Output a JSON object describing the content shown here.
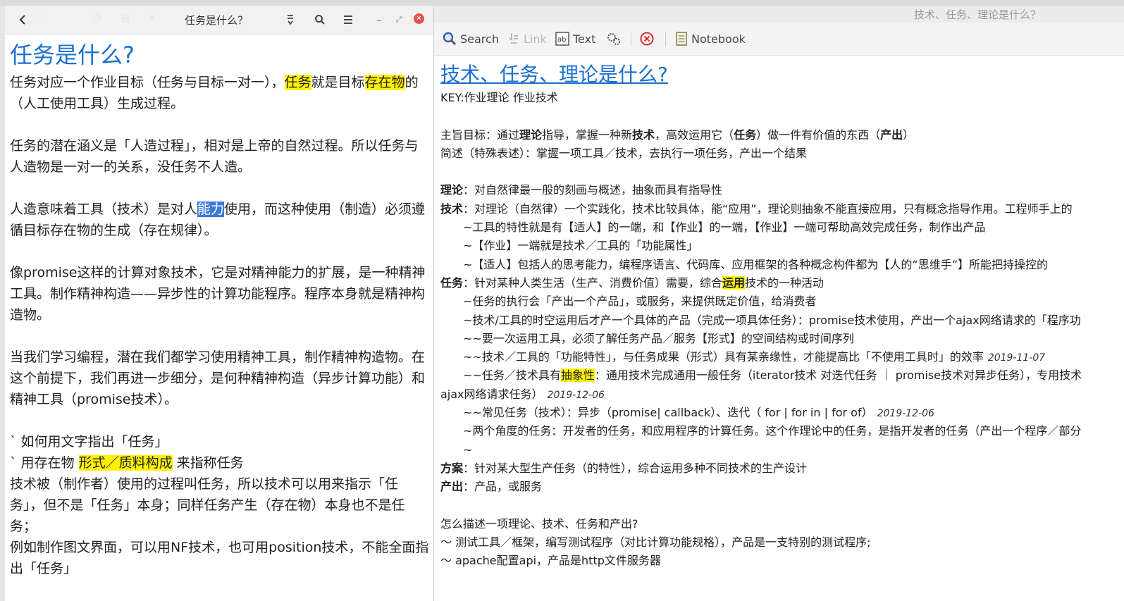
{
  "left_window": {
    "title": "任务是什么？",
    "heading": "任务是什么?",
    "para1_a": "任务对应一个作业目标（任务与目标一对一），",
    "para1_hl1": "任务",
    "para1_b": "就是目标",
    "para1_hl2": "存在物",
    "para1_c": "的（人工使用工具）生成过程。",
    "para2": "任务的潜在涵义是「人造过程」，相对是上帝的自然过程。所以任务与人造物是一对一的关系，没任务不人造。",
    "para3_a": "人造意味着工具（技术）是对人",
    "para3_sel": "能力",
    "para3_b": "使用，而这种使用（制造）必须遵循目标存在物的生成（存在规律）。",
    "para4": "像promise这样的计算对象技术，它是对精神能力的扩展，是一种精神工具。制作精神构造——异步性的计算功能程序。程序本身就是精神构造物。",
    "para5": "当我们学习编程，潜在我们都学习使用精神工具，制作精神构造物。在这个前提下，我们再进一步细分，是何种精神构造（异步计算功能）和精神工具（promise技术）。",
    "bullet1": "` 如何用文字指出「任务」",
    "bullet2_a": "` 用存在物 ",
    "bullet2_hl": "形式／质料构成",
    "bullet2_b": " 来指称任务",
    "para6": "技术被（制作者）使用的过程叫任务，所以技术可以用来指示「任务」，但不是「任务」本身；同样任务产生（存在物）本身也不是任务；",
    "para7": "例如制作图文界面，可以用NF技术，也可用position技术，不能全面指出「任务」"
  },
  "right_window": {
    "title": "技术、任务、理论是什么？",
    "toolbar": {
      "search": "Search",
      "link": "Link",
      "text": "Text",
      "notebook": "Notebook"
    },
    "heading": "技术、任务、理论是什么?",
    "key": "KEY:作业理论 作业技术",
    "l_goal_a": "主旨目标：通过",
    "l_goal_b1": "理论",
    "l_goal_c": "指导，掌握一种新",
    "l_goal_b2": "技术",
    "l_goal_d": "，高效运用它（",
    "l_goal_b3": "任务",
    "l_goal_e": "）做一件有价值的东西（",
    "l_goal_b4": "产出",
    "l_goal_f": "）",
    "l_brief": "简述（特殊表述）：掌握一项工具／技术，去执行一项任务，产出一个结果",
    "theory_label": "理论",
    "theory_text": "：对自然律最一般的刻画与概述，抽象而具有指导性",
    "tech_label": "技术",
    "tech_text": "：对理论（自然律）一个实践化，技术比较具体，能“应用”，理论则抽象不能直接应用，只有概念指导作用。工程师手上的",
    "tech_1": "~工具的特性就是有【适人】的一端，和【作业】的一端，【作业】一端可帮助高效完成任务，制作出产品",
    "tech_2": "~【作业】一端就是技术／工具的「功能属性」",
    "tech_3": "~【适人】包括人的思考能力，编程序语言、代码库、应用框架的各种概念构件都为【人的“思维手”】所能把持操控的",
    "task_label": "任务",
    "task_text_a": "：针对某种人类生活（生产、消费价值）需要，综合",
    "task_hl": "运用",
    "task_text_b": "技术的一种活动",
    "task_1": "~任务的执行会「产出一个产品」，或服务，来提供既定价值，给消费者",
    "task_2": "~技术/工具的时空运用后才产一个具体的产品（完成一项具体任务）：promise技术使用，产出一个ajax网络请求的「程序功",
    "task_3": "~~要一次运用工具，必须了解任务产品／服务【形式】的空间结构或时间序列",
    "task_4": "~~技术／工具的「功能特性」，与任务成果（形式）具有某亲缘性，才能提高比「不使用工具时」的效率",
    "task_4_date": "2019-11-07",
    "task_5_a": "~~任务／技术具有",
    "task_5_hl": "抽象性",
    "task_5_b": "：通用技术完成通用一般任务（iterator技术 对迭代任务 ｜ promise技术对异步任务），专用技术",
    "task_5_cont": "ajax网络请求任务）",
    "task_5_date": "2019-12-06",
    "task_6": "~~常见任务（技术）：异步（promise| callback）、迭代（ for | for in | for of）",
    "task_6_date": "2019-12-06",
    "task_7": "~两个角度的任务：开发者的任务，和应用程序的计算任务。这个作理论中的任务，是指开发者的任务（产出一个程序／部分",
    "task_8": "~",
    "plan_label": "方案",
    "plan_text": "：针对某大型生产任务（的特性），综合运用多种不同技术的生产设计",
    "output_label": "产出",
    "output_text": "：产品，或服务",
    "q": "怎么描述一项理论、技术、任务和产出?",
    "ex1": "～ 测试工具／框架，编写测试程序（对比计算功能规格），产品是一支特别的测试程序;",
    "ex2": "～ apache配置api，产品是http文件服务器"
  },
  "colors": {
    "accent_blue": "#1a6fd0",
    "highlight": "#fff200",
    "selection": "#3d7bd8",
    "close_red": "#e6514f"
  }
}
